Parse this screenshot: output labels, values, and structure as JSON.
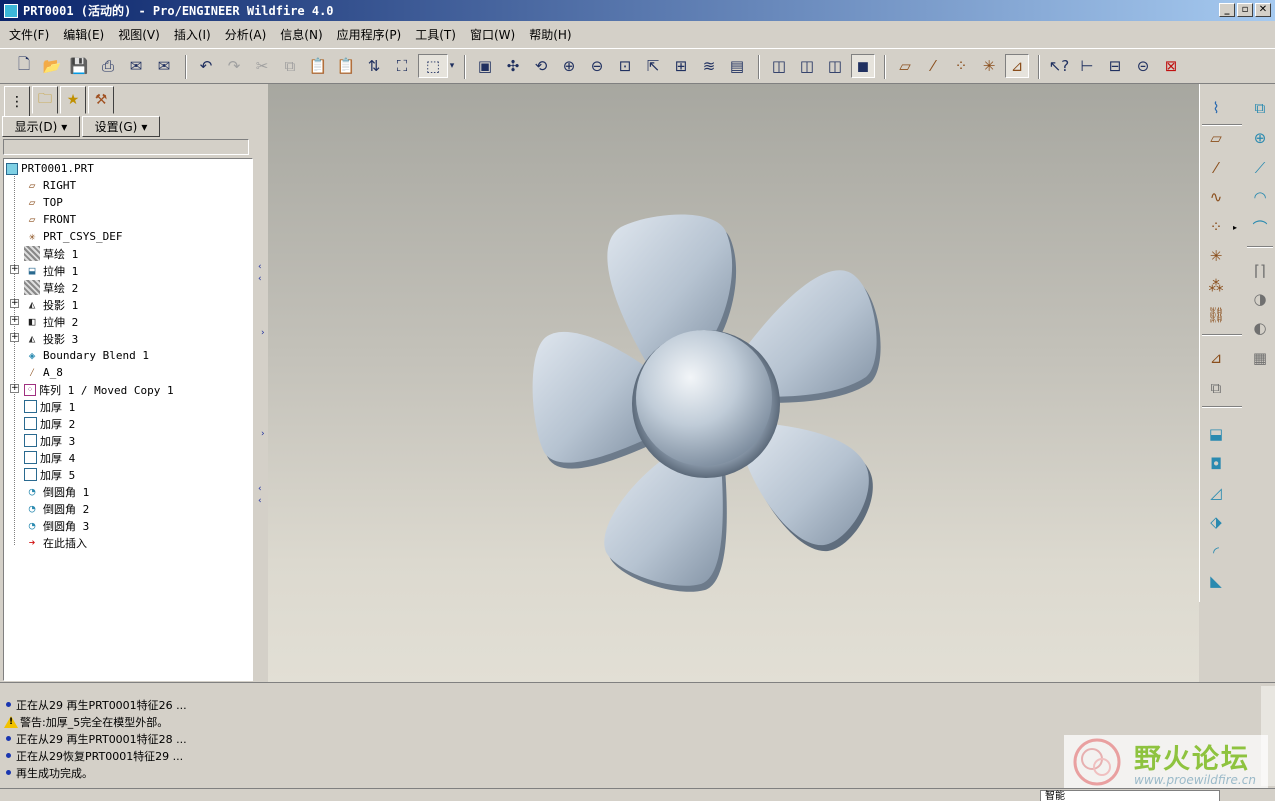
{
  "window": {
    "title": "PRT0001 (活动的) - Pro/ENGINEER Wildfire 4.0",
    "controls": [
      "_",
      "▫",
      "✕"
    ]
  },
  "menu": [
    "文件(F)",
    "编辑(E)",
    "视图(V)",
    "插入(I)",
    "分析(A)",
    "信息(N)",
    "应用程序(P)",
    "工具(T)",
    "窗口(W)",
    "帮助(H)"
  ],
  "toolbar": {
    "icons": [
      "new-icon",
      "open-icon",
      "save-icon",
      "print-icon",
      "email-icon",
      "email-link-icon",
      "undo-icon",
      "redo-icon",
      "cut-icon",
      "copy-icon",
      "paste-icon",
      "paste-special-icon",
      "regenerate-icon",
      "find-icon",
      "selection-box-icon",
      "repaint-icon",
      "spin-center-icon",
      "orient-mode-icon",
      "zoom-in-icon",
      "zoom-out-icon",
      "refit-icon",
      "reorient-icon",
      "saved-views-icon",
      "layers-icon",
      "appearance-icon",
      "wireframe-icon",
      "hidden-line-icon",
      "no-hidden-icon",
      "shading-icon",
      "datum-planes-icon",
      "datum-axes-icon",
      "datum-points-icon",
      "coord-sys-icon",
      "annotations-icon",
      "context-help-icon",
      "measure-icon",
      "section-icon",
      "close-window-icon"
    ]
  },
  "model_tree": {
    "tabs": [
      "model-tree-tab",
      "folder-browser-tab",
      "favorites-tab",
      "connections-tab"
    ],
    "show_button": "显示(D)",
    "settings_button": "设置(G)",
    "items": [
      {
        "label": "PRT0001.PRT",
        "icon": "part-icon"
      },
      {
        "label": "RIGHT",
        "icon": "datum-plane-icon"
      },
      {
        "label": "TOP",
        "icon": "datum-plane-icon"
      },
      {
        "label": "FRONT",
        "icon": "datum-plane-icon"
      },
      {
        "label": "PRT_CSYS_DEF",
        "icon": "csys-icon"
      },
      {
        "label": "草绘 1",
        "icon": "sketch-icon"
      },
      {
        "label": "拉伸 1",
        "icon": "extrude-icon"
      },
      {
        "label": "草绘 2",
        "icon": "sketch-icon"
      },
      {
        "label": "投影 1",
        "icon": "projection-icon"
      },
      {
        "label": "拉伸 2",
        "icon": "extrude-icon"
      },
      {
        "label": "投影 3",
        "icon": "projection-icon"
      },
      {
        "label": "Boundary Blend 1",
        "icon": "boundary-blend-icon"
      },
      {
        "label": "A_8",
        "icon": "datum-axis-icon"
      },
      {
        "label": "阵列 1 / Moved Copy 1",
        "icon": "pattern-icon"
      },
      {
        "label": "加厚 1",
        "icon": "thicken-icon"
      },
      {
        "label": "加厚 2",
        "icon": "thicken-icon"
      },
      {
        "label": "加厚 3",
        "icon": "thicken-icon"
      },
      {
        "label": "加厚 4",
        "icon": "thicken-icon"
      },
      {
        "label": "加厚 5",
        "icon": "thicken-icon"
      },
      {
        "label": "倒圆角 1",
        "icon": "round-icon"
      },
      {
        "label": "倒圆角 2",
        "icon": "round-icon"
      },
      {
        "label": "倒圆角 3",
        "icon": "round-icon"
      },
      {
        "label": "在此插入",
        "icon": "insert-here-arrow-icon"
      }
    ]
  },
  "messages": [
    {
      "type": "info",
      "text": "正在从29 再生PRT0001特征26 ..."
    },
    {
      "type": "warning",
      "text": "警告:加厚_5完全在模型外部。"
    },
    {
      "type": "info",
      "text": "正在从29 再生PRT0001特征28 ..."
    },
    {
      "type": "info",
      "text": "正在从29恢复PRT0001特征29 ..."
    },
    {
      "type": "info",
      "text": "再生成功完成。"
    }
  ],
  "status": {
    "filter_value": "智能"
  },
  "watermark": {
    "title": "野火论坛",
    "url": "www.proewildfire.cn"
  },
  "colors": {
    "title_bar": "#0a246a",
    "model_surface": "#b8c6d4",
    "info_bullet": "#1a36b0",
    "warning": "#f2c200"
  }
}
